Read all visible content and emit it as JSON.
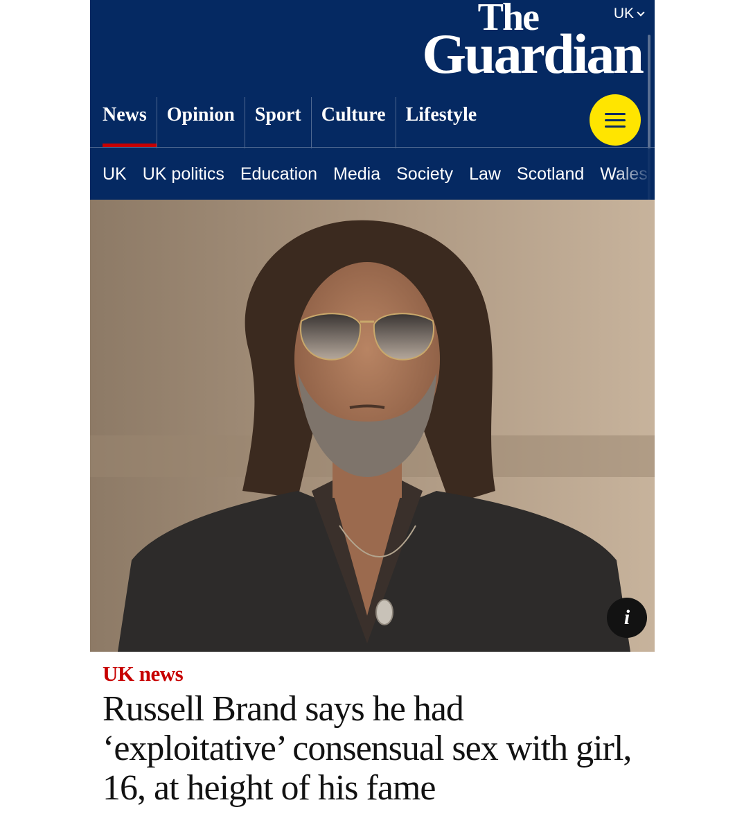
{
  "header": {
    "edition_label": "UK",
    "logo": {
      "line1": "The",
      "line2": "Guardian"
    },
    "pillars": [
      {
        "label": "News",
        "active": true
      },
      {
        "label": "Opinion",
        "active": false
      },
      {
        "label": "Sport",
        "active": false
      },
      {
        "label": "Culture",
        "active": false
      },
      {
        "label": "Lifestyle",
        "active": false
      }
    ],
    "menu_icon": "hamburger-icon",
    "subnav": [
      "UK",
      "UK politics",
      "Education",
      "Media",
      "Society",
      "Law",
      "Scotland",
      "Wales"
    ]
  },
  "photo": {
    "info_icon_label": "i"
  },
  "article": {
    "kicker": "UK news",
    "headline": "Russell Brand says he had ‘exploitative’ consensual sex with girl, 16, at height of his fame"
  },
  "colors": {
    "brand_blue": "#052962",
    "menu_yellow": "#ffe500",
    "kicker_red": "#c70000",
    "text": "#121212"
  }
}
